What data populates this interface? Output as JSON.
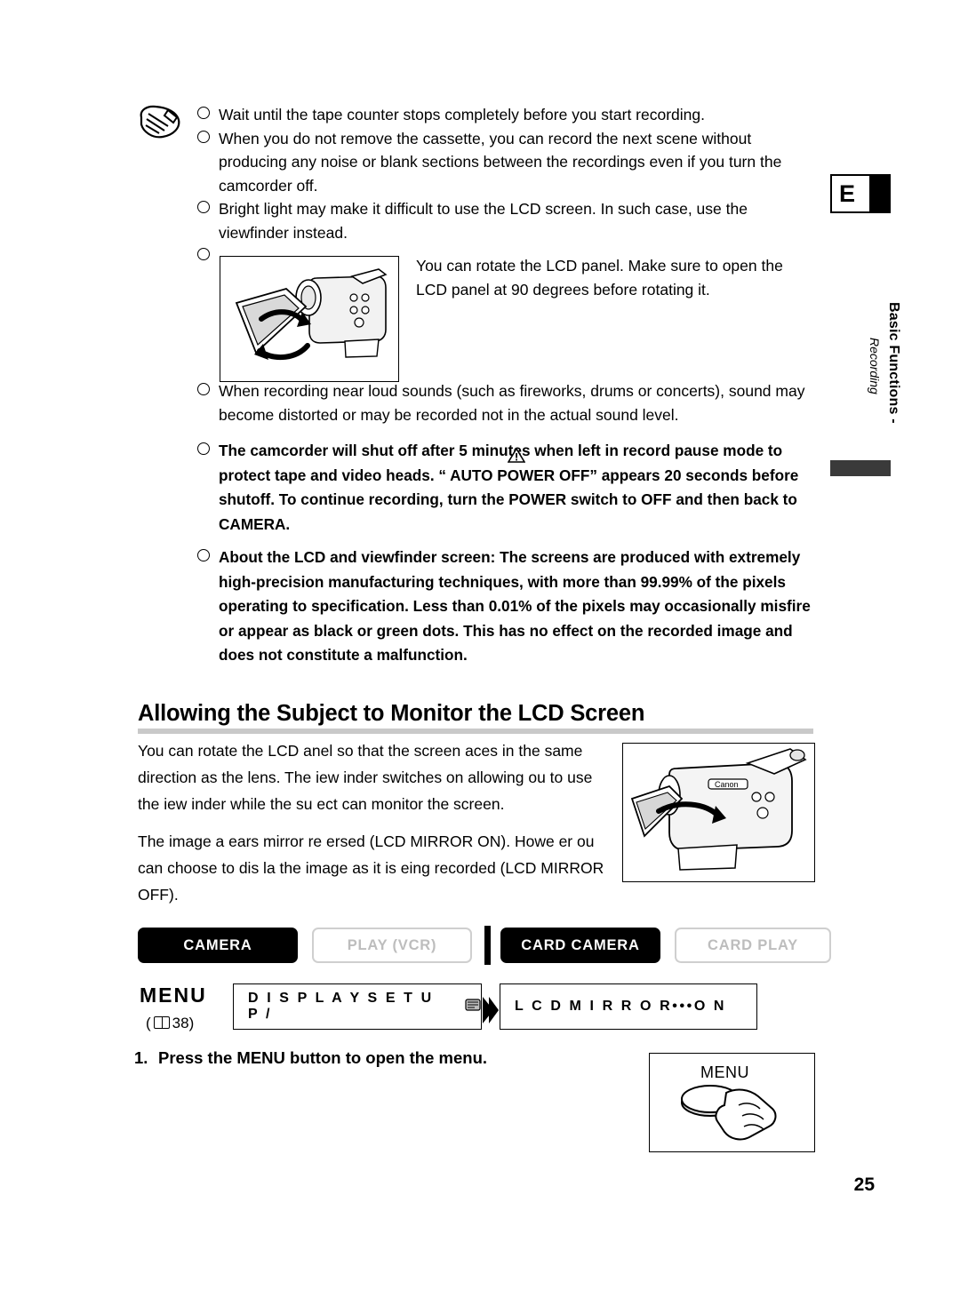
{
  "page": {
    "number": "25",
    "language_tab": "E",
    "side_tab_title": "Basic Functions -",
    "side_tab_sub": "Recording"
  },
  "notes": [
    {
      "text": "Wait until the tape counter stops completely before you start recording.",
      "bold": false
    },
    {
      "text": "When you do not remove the cassette, you can record the next scene without producing any noise or blank sections between the recordings even if you turn the camcorder off.",
      "bold": false
    },
    {
      "text": "Bright light may make it difficult to use the LCD screen. In such case, use the viewfinder instead.",
      "bold": false
    },
    {
      "text": "",
      "bold": false
    },
    {
      "text": "When recording near loud sounds (such as fireworks, drums or concerts), sound may become distorted or may be recorded not in the actual sound level.",
      "bold": false
    },
    {
      "text": "The camcorder will shut off after 5 minutes when left in record pause mode to protect tape and video heads. “      AUTO POWER OFF” appears 20 seconds before shutoff. To continue recording, turn the POWER switch to OFF and then back to CAMERA.",
      "bold": true
    },
    {
      "text": "About the LCD and viewfinder screen: The screens are produced with extremely high-precision manufacturing techniques, with more than 99.99% of the pixels operating to specification. Less than 0.01% of the pixels may occasionally misfire or appear as black or green dots. This has no effect on the recorded image and does not constitute a malfunction.",
      "bold": true
    }
  ],
  "lcd_note": "You can rotate the LCD panel. Make sure to open the LCD panel at 90 degrees before rotating it.",
  "heading": "Allowing the Subject to Monitor the LCD Screen",
  "body": [
    "You can rotate the LCD  anel so that the screen  aces in the same direction as the lens. The  iew inder switches on allowing  ou to use the  iew inder while the su  ect can monitor the screen.",
    "The image a   ears mirror re ersed (LCD MIRROR ON). Howe er  ou can choose to dis  la  the image as it is  eing recorded (LCD MIRROR OFF)."
  ],
  "modes": [
    {
      "label": "CAMERA",
      "state": "on"
    },
    {
      "label": "PLAY (VCR)",
      "state": "off"
    },
    {
      "label": "CARD CAMERA",
      "state": "on"
    },
    {
      "label": "CARD PLAY",
      "state": "off"
    }
  ],
  "menu": {
    "label": "MENU",
    "page_ref": "38",
    "item1": "D I S P L A Y   S E T U P /",
    "item2": "L C D   M I R R O R•••O N"
  },
  "step": {
    "number": "1.",
    "text": "Press the MENU button to open the menu."
  },
  "menu_figure": {
    "caption": "MENU"
  }
}
